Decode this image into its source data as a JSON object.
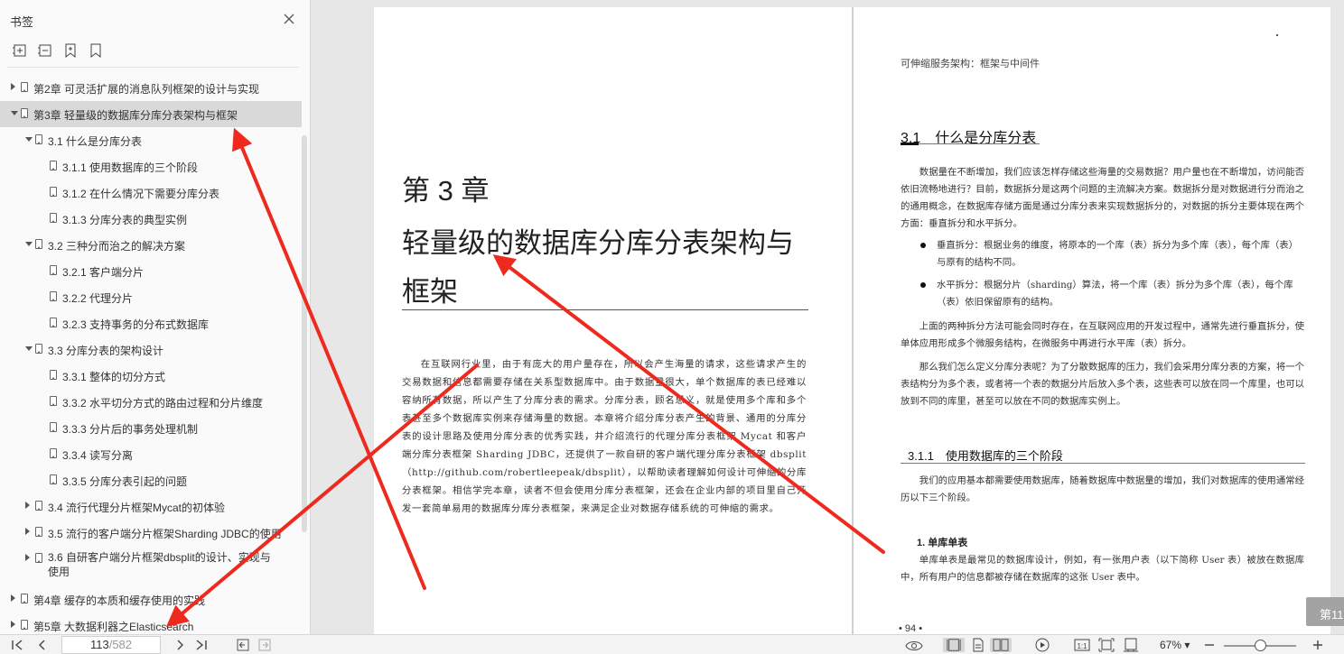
{
  "sidebar": {
    "title": "书签",
    "tools": [
      "expand-all-icon",
      "collapse-all-icon",
      "add-bookmark-icon",
      "bookmark-icon"
    ],
    "items": [
      {
        "label": "第2章 可灵活扩展的消息队列框架的设计与实现",
        "level": 0,
        "expanded": false,
        "selected": false
      },
      {
        "label": "第3章 轻量级的数据库分库分表架构与框架",
        "level": 0,
        "expanded": true,
        "selected": true
      },
      {
        "label": "3.1 什么是分库分表",
        "level": 1,
        "expanded": true,
        "selected": false
      },
      {
        "label": "3.1.1 使用数据库的三个阶段",
        "level": 2,
        "leaf": true
      },
      {
        "label": "3.1.2 在什么情况下需要分库分表",
        "level": 2,
        "leaf": true
      },
      {
        "label": "3.1.3 分库分表的典型实例",
        "level": 2,
        "leaf": true
      },
      {
        "label": "3.2 三种分而治之的解决方案",
        "level": 1,
        "expanded": true
      },
      {
        "label": "3.2.1 客户端分片",
        "level": 2,
        "leaf": true
      },
      {
        "label": "3.2.2 代理分片",
        "level": 2,
        "leaf": true
      },
      {
        "label": "3.2.3 支持事务的分布式数据库",
        "level": 2,
        "leaf": true
      },
      {
        "label": "3.3 分库分表的架构设计",
        "level": 1,
        "expanded": true
      },
      {
        "label": "3.3.1 整体的切分方式",
        "level": 2,
        "leaf": true
      },
      {
        "label": "3.3.2 水平切分方式的路由过程和分片维度",
        "level": 2,
        "leaf": true
      },
      {
        "label": "3.3.3 分片后的事务处理机制",
        "level": 2,
        "leaf": true
      },
      {
        "label": "3.3.4 读写分离",
        "level": 2,
        "leaf": true
      },
      {
        "label": "3.3.5 分库分表引起的问题",
        "level": 2,
        "leaf": true
      },
      {
        "label": "3.4 流行代理分片框架Mycat的初体验",
        "level": 1,
        "expanded": false
      },
      {
        "label": "3.5 流行的客户端分片框架Sharding JDBC的使用",
        "level": 1,
        "expanded": false
      },
      {
        "label": "3.6 自研客户端分片框架dbsplit的设计、实现与使用",
        "level": 1,
        "expanded": false,
        "two_line": true
      },
      {
        "label": "第4章 缓存的本质和缓存使用的实践",
        "level": 0,
        "expanded": false
      },
      {
        "label": "第5章 大数据利器之Elasticsearch",
        "level": 0,
        "expanded": false
      }
    ]
  },
  "left_page": {
    "chapter_number": "第 3 章",
    "chapter_title": "轻量级的数据库分库分表架构与框架",
    "intro": "在互联网行业里，由于有庞大的用户量存在，所以会产生海量的请求，这些请求产生的交易数据和信息都需要存储在关系型数据库中。由于数据量很大，单个数据库的表已经难以容纳所有数据，所以产生了分库分表的需求。分库分表，顾名思义，就是使用多个库和多个表甚至多个数据库实例来存储海量的数据。本章将介绍分库分表产生的背景、通用的分库分表的设计思路及使用分库分表的优秀实践，并介绍流行的代理分库分表框架 Mycat 和客户端分库分表框架 Sharding JDBC，还提供了一款自研的客户端代理分库分表框架 dbsplit（http://github.com/robertleepeak/dbsplit），以帮助读者理解如何设计可伸缩的分库分表框架。相信学完本章，读者不但会使用分库分表框架，还会在企业内部的项目里自己开发一套简单易用的数据库分库分表框架，来满足企业对数据存储系统的可伸缩的需求。"
  },
  "right_page": {
    "running_head": "可伸缩服务架构：框架与中间件",
    "section_title": "3.1　什么是分库分表",
    "p1": "数据量在不断增加，我们应该怎样存储这些海量的交易数据？用户量也在不断增加，访问能否依旧流畅地进行？目前，数据拆分是这两个问题的主流解决方案。数据拆分是对数据进行分而治之的通用概念，在数据库存储方面是通过分库分表来实现数据拆分的，对数据的拆分主要体现在两个方面：垂直拆分和水平拆分。",
    "bullet1": "垂直拆分：根据业务的维度，将原本的一个库（表）拆分为多个库（表），每个库（表）与原有的结构不同。",
    "bullet2": "水平拆分：根据分片（sharding）算法，将一个库（表）拆分为多个库（表），每个库（表）依旧保留原有的结构。",
    "p2": "上面的两种拆分方法可能会同时存在，在互联网应用的开发过程中，通常先进行垂直拆分，使单体应用形成多个微服务结构，在微服务中再进行水平库（表）拆分。",
    "p3": "那么我们怎么定义分库分表呢？为了分散数据库的压力，我们会采用分库分表的方案，将一个表结构分为多个表，或者将一个表的数据分片后放入多个表，这些表可以放在同一个库里，也可以放到不同的库里，甚至可以放在不同的数据库实例上。",
    "subsection_title": "3.1.1　使用数据库的三个阶段",
    "p4": "我们的应用基本都需要使用数据库，随着数据库中数据量的增加，我们对数据库的使用通常经历以下三个阶段。",
    "h4": "1. 单库单表",
    "p5": "单库单表是最常见的数据库设计，例如，有一张用户表（以下简称 User 表）被放在数据库中，所有用户的信息都被存储在数据库的这张 User 表中。",
    "page_number": "• 94 •",
    "side_tab": "第11"
  },
  "toolbar": {
    "current_page": "113",
    "total_pages": "/582",
    "zoom": "67%",
    "zoom_level": 0.5
  }
}
